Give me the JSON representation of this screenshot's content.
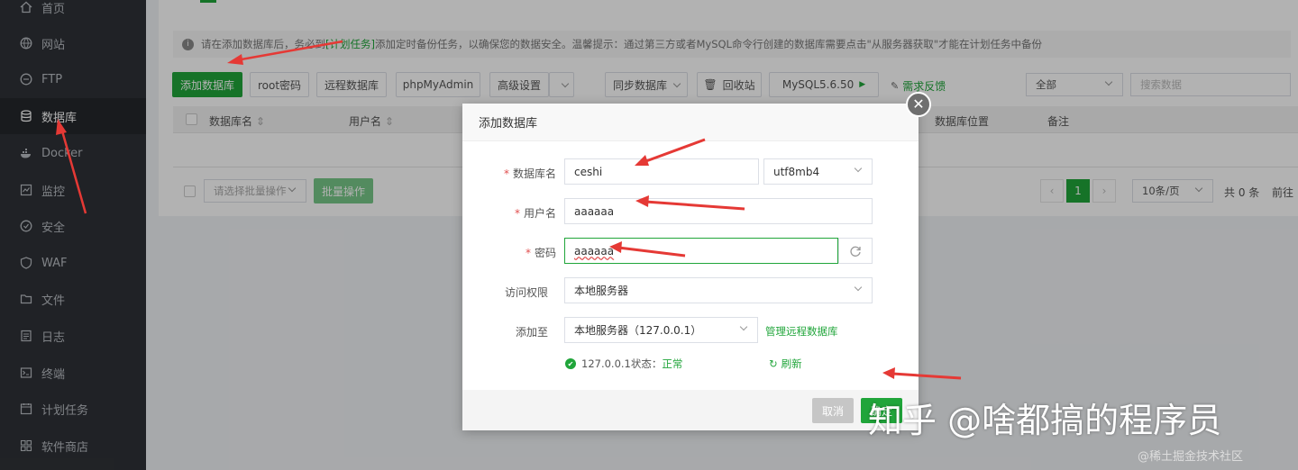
{
  "sidebar": {
    "items": [
      {
        "label": "首页",
        "icon": "home-icon"
      },
      {
        "label": "网站",
        "icon": "globe-icon"
      },
      {
        "label": "FTP",
        "icon": "ftp-icon"
      },
      {
        "label": "数据库",
        "icon": "database-icon",
        "active": true
      },
      {
        "label": "Docker",
        "icon": "docker-icon"
      },
      {
        "label": "监控",
        "icon": "monitor-icon"
      },
      {
        "label": "安全",
        "icon": "shield-icon"
      },
      {
        "label": "WAF",
        "icon": "waf-icon"
      },
      {
        "label": "文件",
        "icon": "folder-icon"
      },
      {
        "label": "日志",
        "icon": "log-icon"
      },
      {
        "label": "终端",
        "icon": "terminal-icon"
      },
      {
        "label": "计划任务",
        "icon": "clock-icon"
      },
      {
        "label": "软件商店",
        "icon": "store-icon"
      }
    ]
  },
  "notice": {
    "part1": "请在添加数据库后，务必到",
    "link": "[计划任务]",
    "part2": "添加定时备份任务，以确保您的数据安全。温馨提示：通过第三方或者MySQL命令行创建的数据库需要点击\"从服务器获取\"才能在计划任务中备份"
  },
  "toolbar": {
    "add_db": "添加数据库",
    "root_pwd": "root密码",
    "remote_db": "远程数据库",
    "phpmyadmin": "phpMyAdmin",
    "advanced": "高级设置",
    "sync_db": "同步数据库",
    "recycle": "回收站",
    "mysql_version": "MySQL5.6.50",
    "feedback": "需求反馈",
    "filter_all": "全部",
    "search_placeholder": "搜索数据"
  },
  "table": {
    "headers": [
      "数据库名",
      "用户名",
      "数据库位置",
      "备注"
    ]
  },
  "bulk": {
    "select_placeholder": "请选择批量操作",
    "batch_button": "批量操作"
  },
  "pager": {
    "current": "1",
    "page_size": "10条/页",
    "total": "共 0 条",
    "goto": "前往"
  },
  "modal": {
    "title": "添加数据库",
    "db_name_label": "数据库名",
    "db_name_value": "ceshi",
    "charset_value": "utf8mb4",
    "username_label": "用户名",
    "username_value": "aaaaaa",
    "password_label": "密码",
    "password_value": "aaaaaa",
    "access_label": "访问权限",
    "access_value": "本地服务器",
    "add_to_label": "添加至",
    "add_to_value": "本地服务器（127.0.0.1）",
    "manage_remote": "管理远程数据库",
    "status_text": "127.0.0.1状态：",
    "status_value": "正常",
    "refresh": "刷新",
    "cancel": "取消",
    "confirm": "确定",
    "required_mark": "*"
  },
  "watermark": {
    "main": "知乎 @啥都搞的程序员",
    "corner": "@稀土掘金技术社区"
  },
  "colors": {
    "brand": "#20a53a",
    "sidebar_bg": "#2f3237",
    "arrow": "#e53935"
  }
}
